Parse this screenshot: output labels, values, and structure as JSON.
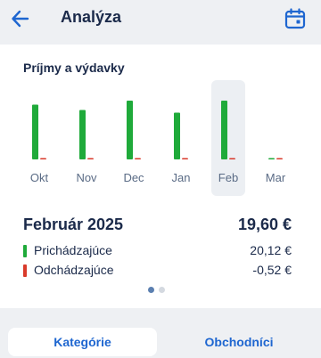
{
  "header": {
    "title": "Analýza",
    "back_icon": "arrow-left-icon",
    "calendar_icon": "calendar-icon"
  },
  "card": {
    "title": "Príjmy a výdavky"
  },
  "chart_data": {
    "type": "bar",
    "categories": [
      "Okt",
      "Nov",
      "Dec",
      "Jan",
      "Feb",
      "Mar"
    ],
    "series": [
      {
        "values": [
          20.5,
          18.5,
          22.0,
          17.5,
          22.0,
          0.1
        ],
        "color": "#1faa3a"
      },
      {
        "values": [
          0.5,
          0.5,
          0.5,
          0.5,
          0.52,
          0.3
        ],
        "color": "#d93a2b"
      }
    ],
    "ylim": [
      0,
      24
    ],
    "highlighted_category": "Feb",
    "grid": false,
    "legend": "none"
  },
  "summary": {
    "month": "Február 2025",
    "total": "19,60 €",
    "incoming_label": "Prichádzajúce",
    "incoming_value": "20,12 €",
    "outgoing_label": "Odchádzajúce",
    "outgoing_value": "-0,52 €"
  },
  "pager": {
    "pages": 2,
    "current": 1
  },
  "tabs": [
    {
      "label": "Kategórie",
      "active": true
    },
    {
      "label": "Obchodníci",
      "active": false
    }
  ],
  "colors": {
    "accent": "#1e66d0",
    "income": "#1faa3a",
    "expense": "#d93a2b",
    "highlight": "#eceff3",
    "dot_active": "#5b7fb0",
    "dot_inactive": "#d4d9e0"
  }
}
